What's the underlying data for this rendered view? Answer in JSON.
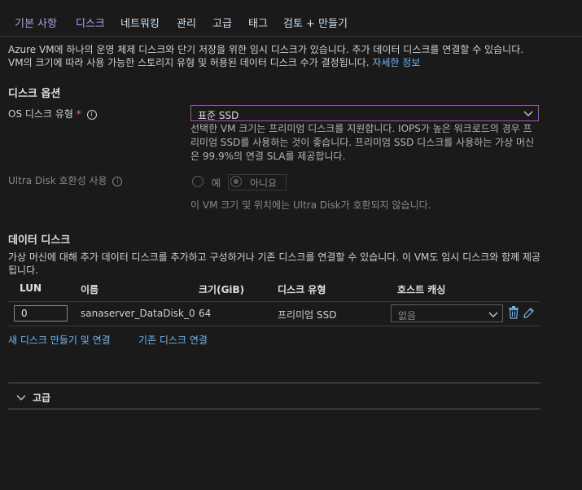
{
  "tabs": [
    "기본 사항",
    "디스크",
    "네트워킹",
    "관리",
    "고급",
    "태그",
    "검토 + 만들기"
  ],
  "intro": {
    "text": "Azure VM에 하나의 운영 체제 디스크와 단기 저장을 위한 임시 디스크가 있습니다. 추가 데이터 디스크를 연결할 수 있습니다. VM의 크기에 따라 사용 가능한 스토리지 유형 및 허용된 데이터 디스크 수가 결정됩니다.",
    "link": "자세한 정보"
  },
  "disk_options": {
    "title": "디스크 옵션",
    "os_disk_label": "OS 디스크 유형",
    "required_mark": "*",
    "os_disk_value": "표준 SSD",
    "os_disk_help": "선택한 VM 크기는 프리미엄 디스크를 지원합니다. IOPS가 높은 워크로드의 경우 프리미엄 SSD를 사용하는 것이 좋습니다. 프리미엄 SSD 디스크를 사용하는 가상 머신은 99.9%의 연결 SLA를 제공합니다.",
    "ultra_label": "Ultra Disk 호환성 사용",
    "ultra_yes": "예",
    "ultra_no": "아니요",
    "ultra_note": "이 VM 크기 및 위치에는 Ultra Disk가 호환되지 않습니다."
  },
  "data_disks": {
    "title": "데이터 디스크",
    "description": "가상 머신에 대해 추가 데이터 디스크를 추가하고 구성하거나 기존 디스크를 연결할 수 있습니다. 이 VM도 임시 디스크와 함께 제공됩니다.",
    "columns": [
      "LUN",
      "이름",
      "크기(GiB)",
      "디스크 유형",
      "호스트 캐싱"
    ],
    "rows": [
      {
        "lun": "0",
        "name": "sanaserver_DataDisk_0",
        "size": "64",
        "type": "프리미엄 SSD",
        "caching": "없음"
      }
    ],
    "create_link": "새 디스크 만들기 및 연결",
    "attach_link": "기존 디스크 연결"
  },
  "advanced": {
    "label": "고급"
  },
  "colors": {
    "accent": "#a44fbf",
    "link": "#6cb8f6",
    "background": "#1b1a19"
  }
}
